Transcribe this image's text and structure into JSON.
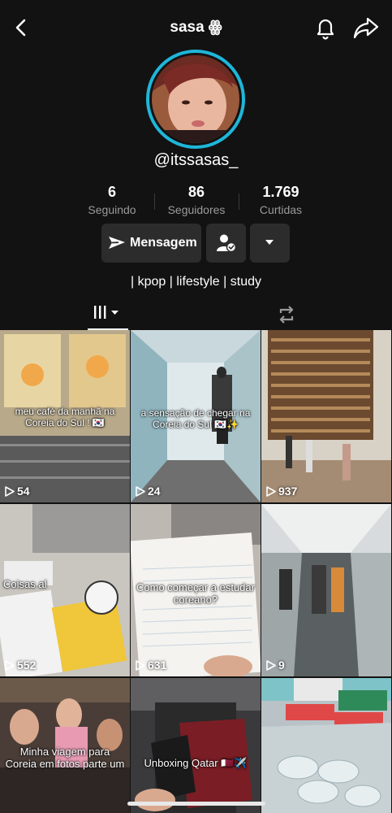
{
  "header": {
    "username": "sasa ꙮ",
    "handle": "@itssasas_"
  },
  "stats": [
    {
      "value": "6",
      "label": "Seguindo"
    },
    {
      "value": "86",
      "label": "Seguidores"
    },
    {
      "value": "1.769",
      "label": "Curtidas"
    }
  ],
  "actions": {
    "message_label": "Mensagem"
  },
  "bio": "| kpop | lifestyle | study",
  "colors": {
    "accent_ring": "#1fb6d9",
    "background": "#121212",
    "button_bg": "#2c2c2c"
  },
  "videos": [
    {
      "caption": "meu café da manhã na Coreia do Sul ! 🇰🇷",
      "views": "54"
    },
    {
      "caption": "a sensação de chegar na Coreia do Sul 🇰🇷✨",
      "views": "24"
    },
    {
      "caption": "",
      "views": "937"
    },
    {
      "caption": "Coisas al",
      "views": "552"
    },
    {
      "caption": "Como começar a estudar coreano?",
      "views": "631"
    },
    {
      "caption": "",
      "views": "9"
    },
    {
      "caption": "Minha viagem para Coreia em fotos parte um",
      "views": ""
    },
    {
      "caption": "Unboxing Qatar 🇶🇦✈️",
      "views": ""
    },
    {
      "caption": "",
      "views": ""
    }
  ]
}
